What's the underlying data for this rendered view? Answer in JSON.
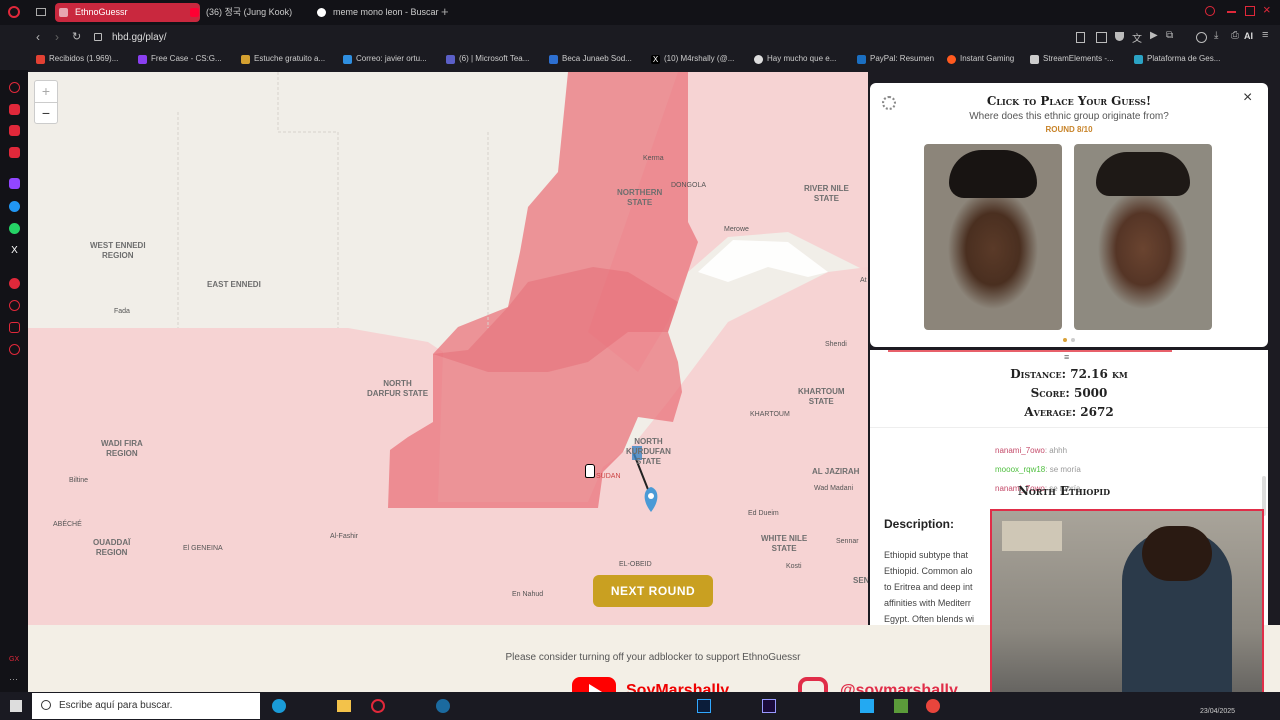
{
  "browser": {
    "tabs": [
      {
        "label": "EthnoGuessr",
        "active": true
      },
      {
        "label": "(36) 정국 (Jung Kook)"
      },
      {
        "label": "meme mono leon - Buscar"
      }
    ],
    "url": "hbd.gg/play/",
    "bookmarks": [
      "Recibidos (1.969)...",
      "Free Case - CS:G...",
      "Estuche gratuito a...",
      "Correo: javier ortu...",
      "(6) | Microsoft Tea...",
      "Beca Junaeb Sod...",
      "(10) M4rshally (@...",
      "Hay mucho que e...",
      "PayPal: Resumen",
      "Instant Gaming",
      "StreamElements -...",
      "Plataforma de Ges..."
    ],
    "ai_label": "AI"
  },
  "map": {
    "zoom_in": "+",
    "zoom_out": "−",
    "regions": [
      {
        "label": "WEST ENNEDI\nREGION"
      },
      {
        "label": "EAST ENNEDI"
      },
      {
        "label": "NORTHERN\nSTATE"
      },
      {
        "label": "RIVER NILE\nSTATE"
      },
      {
        "label": "NORTH\nDARFUR STATE"
      },
      {
        "label": "KHARTOUM\nSTATE"
      },
      {
        "label": "WADI FIRA\nREGION"
      },
      {
        "label": "NORTH\nKURDUFAN\nSTATE"
      },
      {
        "label": "AL JAZIRAH"
      },
      {
        "label": "OUADDAÏ\nREGION"
      },
      {
        "label": "WHITE NILE\nSTATE"
      },
      {
        "label": "SEN"
      }
    ],
    "cities": [
      "Kerma",
      "DONGOLA",
      "Merowe",
      "Fada",
      "Shendi",
      "KHARTOUM",
      "Biltine",
      "Wad Madani",
      "ABÉCHÉ",
      "Ed Dueim",
      "El GENEINA",
      "Al-Fashir",
      "Sennar",
      "EL-OBEID",
      "Kosti",
      "En Nahud",
      "SUDAN",
      "At"
    ],
    "next_round": "NEXT ROUND"
  },
  "panel": {
    "title": "Click to Place Your Guess!",
    "subtitle": "Where does this ethnic group originate from?",
    "round": "ROUND 8/10"
  },
  "results": {
    "distance": "Distance: 72.16 km",
    "score": "Score: 5000",
    "average": "Average: 2672",
    "chat": [
      {
        "user": "nanami_7owo",
        "msg": ": ahhh"
      },
      {
        "user": "mooox_rqw18",
        "msg": ": se moría"
      },
      {
        "user": "nanami_7owo",
        "msg": ": se moría"
      }
    ],
    "group_name": "North Ethiopid",
    "description_label": "Description:",
    "description_lines": [
      "Ethiopid subtype that",
      "Ethiopid. Common alo",
      "to Eritrea and deep int",
      "affinities with Mediterr",
      "Egypt. Often blends wi"
    ]
  },
  "footer": {
    "message": "Please consider turning off your adblocker to support EthnoGuessr",
    "youtube": "SoyMarshally",
    "instagram": "@soymarshally"
  },
  "taskbar": {
    "search_placeholder": "Escribe aquí para buscar.",
    "date": "23/04/2025"
  },
  "colors": {
    "accent_red": "#e8606a",
    "button_gold": "#c9a021",
    "panel_title": "#1d1d1d",
    "round_color": "#c8842a"
  }
}
